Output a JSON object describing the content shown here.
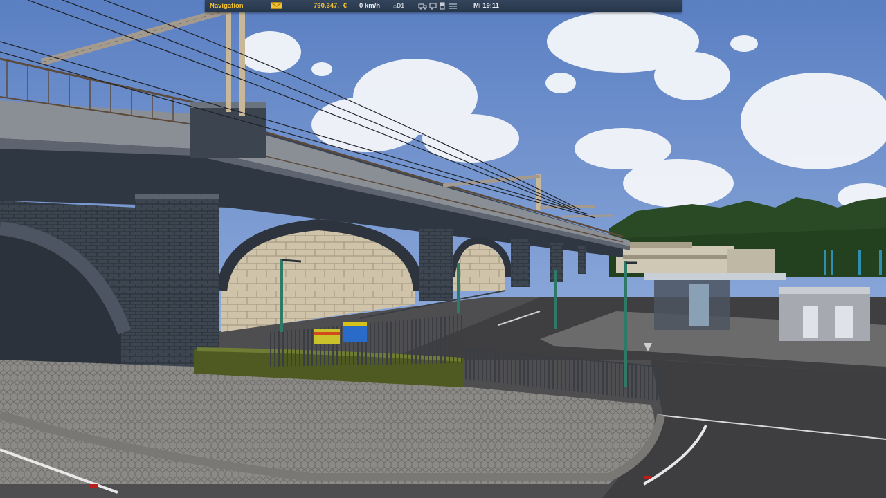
{
  "hud": {
    "navigation_label": "Navigation",
    "money": "790.347,- €",
    "speed": "0 km/h",
    "tachograph": "D1",
    "tachograph_icon": "tachograph-icon",
    "mail_icon": "envelope-icon",
    "status_icons": [
      "truck-icon",
      "trailer-icon",
      "fuel-icon",
      "settings-icon"
    ],
    "time": "Mi 19:11",
    "accent_color": "#f2c232",
    "bar_color": "#2c3d53"
  }
}
